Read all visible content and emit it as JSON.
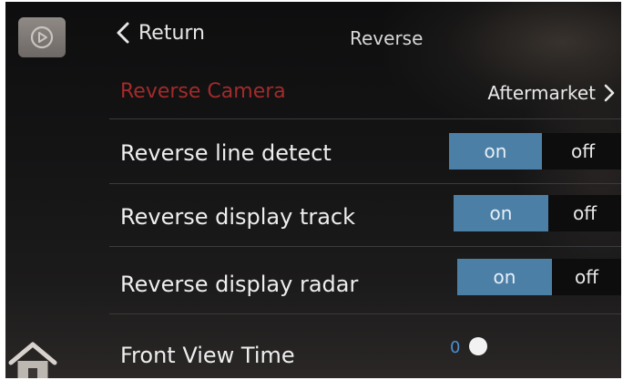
{
  "header": {
    "return_label": "Return",
    "title": "Reverse",
    "media_icon": "play-circle-icon"
  },
  "settings": {
    "reverse_camera": {
      "label": "Reverse Camera",
      "value": "Aftermarket"
    },
    "rows": [
      {
        "label": "Reverse line detect",
        "on_label": "on",
        "off_label": "off",
        "selected": "on"
      },
      {
        "label": "Reverse display track",
        "on_label": "on",
        "off_label": "off",
        "selected": "on"
      },
      {
        "label": "Reverse display radar",
        "on_label": "on",
        "off_label": "off",
        "selected": "on"
      }
    ],
    "front_view_time": {
      "label": "Front View Time",
      "value": "0"
    }
  },
  "nav": {
    "home_icon": "home-icon"
  },
  "colors": {
    "background": "#141415",
    "accent_on": "#4c7fa6",
    "camera_label": "#a32a2a",
    "slider_value": "#4a8fd0"
  }
}
